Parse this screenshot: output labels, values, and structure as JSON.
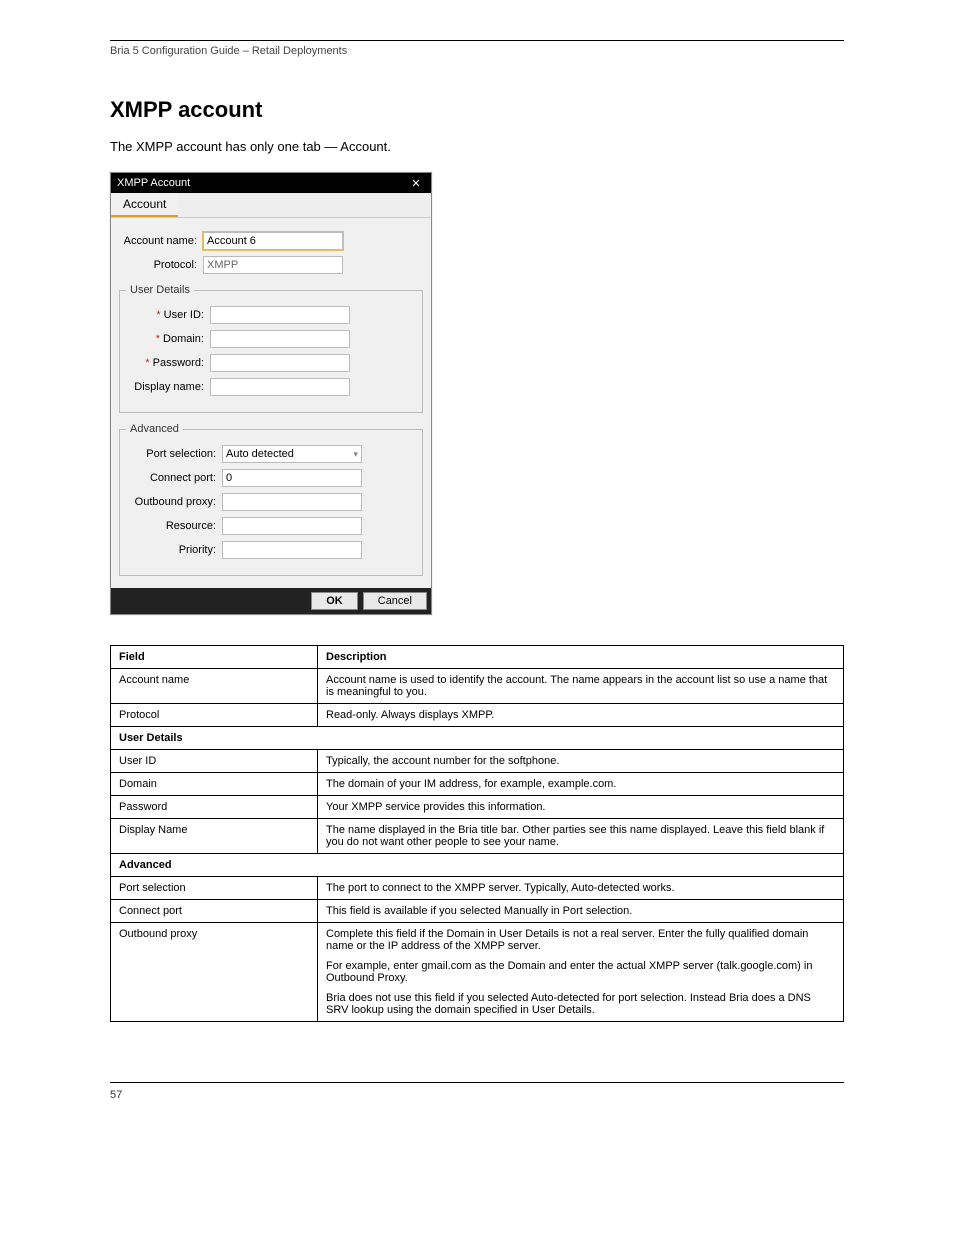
{
  "header": {
    "doc_title": "Bria 5 Configuration Guide – Retail Deployments"
  },
  "section": {
    "title": "XMPP account",
    "intro": "The XMPP account has only one tab — Account."
  },
  "dialog": {
    "title": "XMPP Account",
    "tab": "Account",
    "fields": {
      "account_name_label": "Account name:",
      "account_name_value": "Account 6",
      "protocol_label": "Protocol:",
      "protocol_value": "XMPP"
    },
    "user_details": {
      "legend": "User Details",
      "user_id_label": "* User ID:",
      "domain_label": "* Domain:",
      "password_label": "* Password:",
      "display_name_label": "Display name:"
    },
    "advanced": {
      "legend": "Advanced",
      "port_selection_label": "Port selection:",
      "port_selection_value": "Auto detected",
      "connect_port_label": "Connect port:",
      "connect_port_value": "0",
      "outbound_proxy_label": "Outbound proxy:",
      "resource_label": "Resource:",
      "priority_label": "Priority:"
    },
    "buttons": {
      "ok": "OK",
      "cancel": "Cancel"
    }
  },
  "table": {
    "head_field": "Field",
    "head_desc": "Description",
    "rows": [
      {
        "field": "Account name",
        "desc": "Account name is used to identify the account. The name appears in the account list so use a name that is meaningful to you."
      },
      {
        "field": "Protocol",
        "desc": "Read-only. Always displays XMPP."
      },
      {
        "section": "User Details"
      },
      {
        "field": "User ID",
        "desc": "Typically, the account number for the softphone."
      },
      {
        "field": "Domain",
        "desc": "The domain of your IM address, for example, example.com."
      },
      {
        "field": "Password",
        "desc": "Your XMPP service provides this information."
      },
      {
        "field": "Display Name",
        "desc": "The name displayed in the Bria title bar. Other parties see this name displayed. Leave this field blank if you do not want other people to see your name."
      },
      {
        "section": "Advanced"
      },
      {
        "field": "Port selection",
        "desc": "The port to connect to the XMPP server. Typically, Auto-detected works."
      },
      {
        "field": "Connect port",
        "desc": "This field is available if you selected Manually in Port selection."
      },
      {
        "field": "Outbound proxy",
        "desc_p1": "Complete this field if the Domain in User Details is not a real server. Enter the fully qualified domain name or the IP address of the XMPP server.",
        "desc_p2": "For example, enter gmail.com as the Domain and enter the actual XMPP server (talk.google.com) in Outbound Proxy.",
        "desc_p3": "Bria does not use this field if you selected Auto-detected for port selection. Instead Bria does a DNS SRV lookup using the domain specified in User Details."
      }
    ]
  },
  "footer": {
    "page": "57"
  },
  "chart_data": {
    "type": "table",
    "title": "XMPP Account – Account tab field descriptions",
    "columns": [
      "Field",
      "Description"
    ],
    "sections": [
      {
        "name": "",
        "rows": [
          [
            "Account name",
            "Account name is used to identify the account. The name appears in the account list so use a name that is meaningful to you."
          ],
          [
            "Protocol",
            "Read-only. Always displays XMPP."
          ]
        ]
      },
      {
        "name": "User Details",
        "rows": [
          [
            "User ID",
            "Typically, the account number for the softphone."
          ],
          [
            "Domain",
            "The domain of your IM address, for example, example.com."
          ],
          [
            "Password",
            "Your XMPP service provides this information."
          ],
          [
            "Display Name",
            "The name displayed in the Bria title bar. Other parties see this name displayed. Leave this field blank if you do not want other people to see your name."
          ]
        ]
      },
      {
        "name": "Advanced",
        "rows": [
          [
            "Port selection",
            "The port to connect to the XMPP server. Typically, Auto-detected works."
          ],
          [
            "Connect port",
            "This field is available if you selected Manually in Port selection."
          ],
          [
            "Outbound proxy",
            "Complete this field if the Domain in User Details is not a real server. Enter the fully qualified domain name or the IP address of the XMPP server. For example, enter gmail.com as the Domain and enter the actual XMPP server (talk.google.com) in Outbound Proxy. Bria does not use this field if you selected Auto-detected for port selection. Instead Bria does a DNS SRV lookup using the domain specified in User Details."
          ]
        ]
      }
    ]
  }
}
